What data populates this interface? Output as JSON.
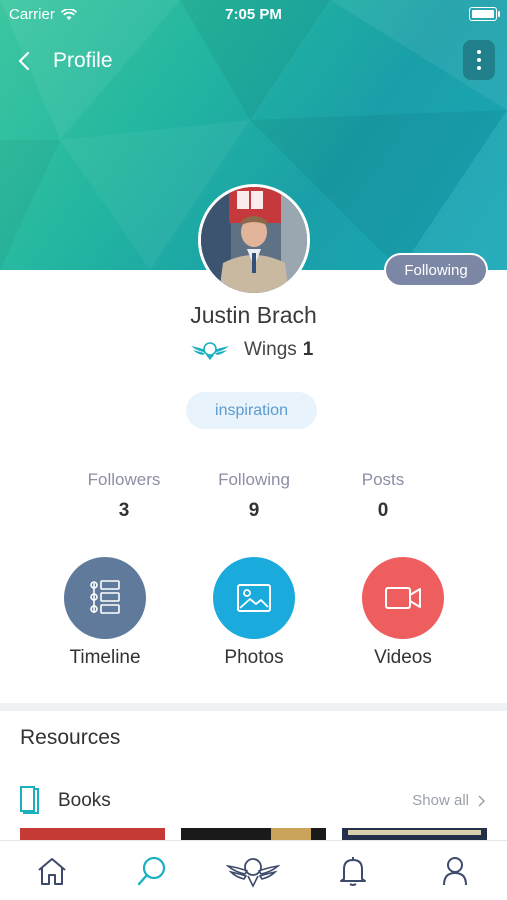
{
  "status": {
    "carrier": "Carrier",
    "time": "7:05 PM",
    "battery_level": 1.0
  },
  "nav": {
    "title": "Profile",
    "back_icon": "chevron-left-icon",
    "more_icon": "more-vertical-icon"
  },
  "profile": {
    "name": "Justin Brach",
    "wings_label": "Wings",
    "wings_count": "1",
    "following_button": "Following",
    "tag": "inspiration"
  },
  "stats": [
    {
      "label": "Followers",
      "value": "3"
    },
    {
      "label": "Following",
      "value": "9"
    },
    {
      "label": "Posts",
      "value": "0"
    }
  ],
  "actions": [
    {
      "label": "Timeline",
      "icon": "timeline-icon",
      "color": "#5f7a9a"
    },
    {
      "label": "Photos",
      "icon": "photo-icon",
      "color": "#1aabdc"
    },
    {
      "label": "Videos",
      "icon": "video-camera-icon",
      "color": "#ef5e5e"
    }
  ],
  "resources": {
    "title": "Resources",
    "books_label": "Books",
    "show_all": "Show all"
  },
  "tabbar": [
    {
      "name": "home-icon"
    },
    {
      "name": "search-icon",
      "active": true
    },
    {
      "name": "wings-logo-icon"
    },
    {
      "name": "bell-icon"
    },
    {
      "name": "user-icon"
    }
  ],
  "colors": {
    "banner_start": "#3cc7a0",
    "banner_end": "#1aa8b8",
    "following_button": "#7b87a5",
    "tag_text": "#5b9bd1",
    "accent": "#1ab0c0"
  }
}
